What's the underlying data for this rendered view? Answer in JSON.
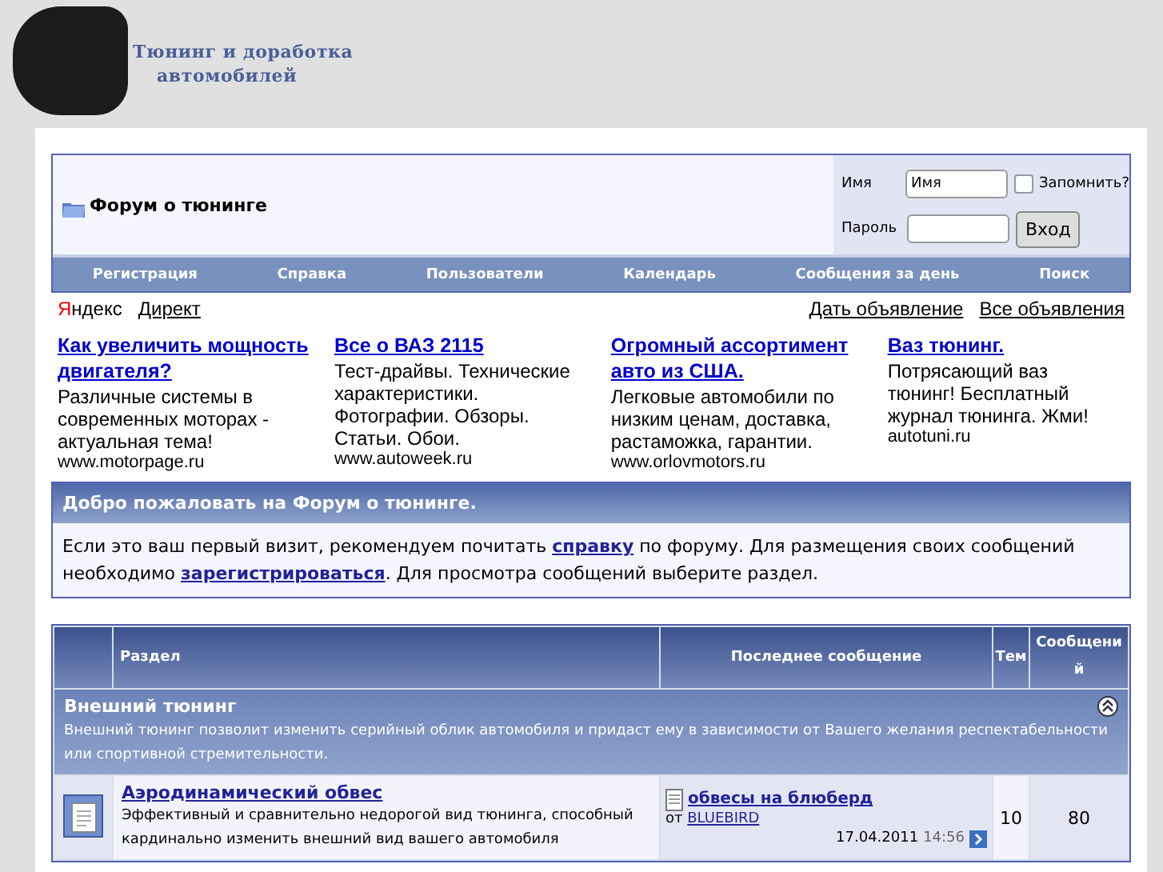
{
  "header": {
    "logo_line1": "Тюнинг и доработка",
    "logo_line2": "автомобилей"
  },
  "forum": {
    "title": "Форум о тюнинге",
    "nav": [
      "Регистрация",
      "Справка",
      "Пользователи",
      "Календарь",
      "Сообщения за день",
      "Поиск"
    ],
    "login": {
      "name_label": "Имя",
      "name_value": "Имя",
      "remember_label": "Запомнить?",
      "remember_checked": false,
      "password_label": "Пароль",
      "login_button": "Вход"
    }
  },
  "ads": {
    "provider": "Яндекс",
    "direct_link": "Директ",
    "right_links": [
      "Дать объявление",
      "Все объявления"
    ],
    "items": [
      {
        "title": "Как увеличить мощность двигателя?",
        "text": "Различные системы в современных моторах - актуальная тема!",
        "url": "www.motorpage.ru"
      },
      {
        "title": "Все о ВАЗ 2115",
        "text": "Тест-драйвы. Технические характеристики. Фотографии. Обзоры. Статьи. Обои.",
        "url": "www.autoweek.ru"
      },
      {
        "title": "Огромный ассортимент авто из США.",
        "text": "Легковые автомобили по низким ценам, доставка, растаможка, гарантии.",
        "url": "www.orlovmotors.ru"
      },
      {
        "title": "Ваз тюнинг.",
        "text": "Потрясающий ваз тюнинг! Бесплатный журнал тюнинга. Жми!",
        "url": "autotuni.ru"
      }
    ]
  },
  "welcome": {
    "title": "Добро пожаловать на Форум о тюнинге.",
    "parts": [
      {
        "kind": "text",
        "text": "Если это ваш первый визит, рекомендуем почитать "
      },
      {
        "kind": "link",
        "text": "справку"
      },
      {
        "kind": "text",
        "text": " по форуму. Для размещения своих сообщений необходимо "
      },
      {
        "kind": "link",
        "text": "зарегистрироваться"
      },
      {
        "kind": "text",
        "text": ". Для просмотра сообщений выберите раздел."
      }
    ]
  },
  "table": {
    "columns": [
      "Раздел",
      "Последнее сообщение",
      "Тем",
      "Сообщений"
    ],
    "category": {
      "title": "Внешний тюнинг",
      "description": "Внешний тюнинг позволит изменить серийный облик автомобиля и придаст ему в зависимости от Вашего желания респектабельности или спортивной стремительности.",
      "expanded": true
    },
    "forums": [
      {
        "title": "Аэродинамический обвес",
        "description": "Эффективный и сравнительно недорогой вид тюнинга, способный кардинально изменить внешний вид вашего автомобиля",
        "last_post": {
          "title": "обвесы на блюберд",
          "by_label": "от",
          "author": "BLUEBIRD",
          "date": "17.04.2011",
          "time": "14:56"
        },
        "threads": "10",
        "posts": "80"
      }
    ]
  }
}
